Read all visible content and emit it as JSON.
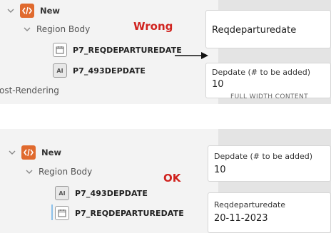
{
  "top": {
    "new_label": "New",
    "region_label": "Region Body",
    "item1_label": "P7_REQDEPARTUREDATE",
    "item2_label": "P7_493DEPDATE",
    "post_rendering_label": "ost-Rendering",
    "verdict": "Wrong",
    "field1_value": "Reqdeparturedate",
    "field2_label": "Depdate (# to be added)",
    "field2_value": "10",
    "under_label": "FULL WIDTH CONTENT"
  },
  "bottom": {
    "new_label": "New",
    "region_label": "Region Body",
    "item1_label": "P7_493DEPDATE",
    "item2_label": "P7_REQDEPARTUREDATE",
    "verdict": "OK",
    "field1_label": "Depdate (# to be added)",
    "field1_value": "10",
    "field2_label": "Reqdeparturedate",
    "field2_value": "20-11-2023"
  },
  "icons": {
    "component": "code-brackets-icon",
    "date_item": "calendar-icon",
    "text_item": "text-field-icon",
    "chevron": "chevron-down-icon",
    "arrow": "arrow-right-icon"
  },
  "colors": {
    "component_orange": "#e06a2e",
    "verdict_red": "#d0231f",
    "selection_blue": "#8cc1ea"
  }
}
